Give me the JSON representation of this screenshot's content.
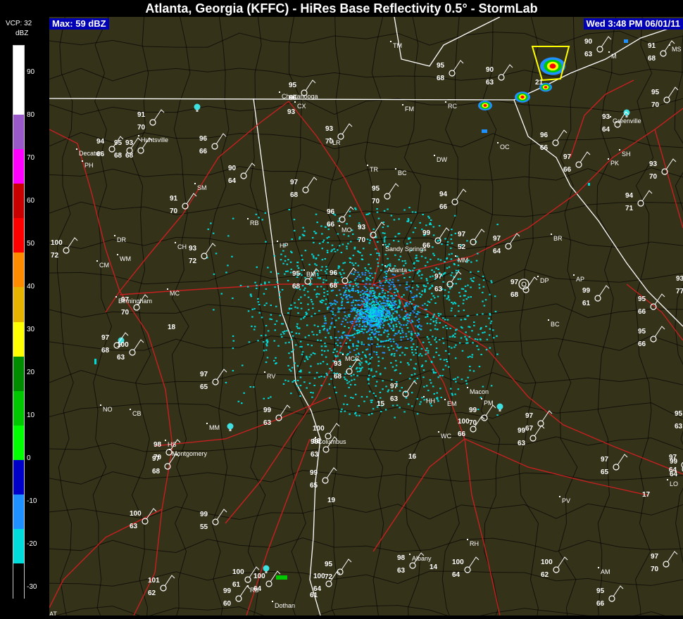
{
  "title": "Atlanta, Georgia (KFFC) - HiRes Base Reflectivity 0.5° - StormLab",
  "max_label": "Max: 59 dBZ",
  "time_label": "Wed 3:48 PM 06/01/11",
  "legend": {
    "vcp": "VCP: 32",
    "unit": "dBZ",
    "ticks": [
      "90",
      "80",
      "70",
      "60",
      "50",
      "40",
      "30",
      "20",
      "10",
      "0",
      "-10",
      "-20",
      "-30"
    ],
    "colors": [
      "#ffffff",
      "#ffffff",
      "#9a59c8",
      "#ff00ff",
      "#c80000",
      "#ff0000",
      "#ff8c00",
      "#e6b400",
      "#ffff00",
      "#008c00",
      "#00c800",
      "#00ff00",
      "#0000c8",
      "#1e90ff",
      "#00dcdc",
      "#000000"
    ]
  },
  "cities": [
    {
      "name": "TM"
    },
    {
      "name": "FM"
    },
    {
      "name": "RC"
    },
    {
      "name": "Chattanooga"
    },
    {
      "name": "CX"
    },
    {
      "name": "LR"
    },
    {
      "name": "Huntsville"
    },
    {
      "name": "Decatur"
    },
    {
      "name": "PH"
    },
    {
      "name": "SM"
    },
    {
      "name": "TR"
    },
    {
      "name": "BC"
    },
    {
      "name": "DW"
    },
    {
      "name": "OC"
    },
    {
      "name": "Greenville"
    },
    {
      "name": "SH"
    },
    {
      "name": "PK"
    },
    {
      "name": "RB"
    },
    {
      "name": "MO"
    },
    {
      "name": "HP"
    },
    {
      "name": "DR"
    },
    {
      "name": "WM"
    },
    {
      "name": "CM"
    },
    {
      "name": "CH"
    },
    {
      "name": "Sandy Springs"
    },
    {
      "name": "MM"
    },
    {
      "name": "BR"
    },
    {
      "name": "Atlanta"
    },
    {
      "name": "BM"
    },
    {
      "name": "Birmingham"
    },
    {
      "name": "MC"
    },
    {
      "name": "DP"
    },
    {
      "name": "AP"
    },
    {
      "name": "BC"
    },
    {
      "name": "MCC"
    },
    {
      "name": "RV"
    },
    {
      "name": "NO"
    },
    {
      "name": "CB"
    },
    {
      "name": "MM"
    },
    {
      "name": "HS"
    },
    {
      "name": "Montgomery"
    },
    {
      "name": "Columbus"
    },
    {
      "name": "HH"
    },
    {
      "name": "Macon"
    },
    {
      "name": "EM"
    },
    {
      "name": "PM"
    },
    {
      "name": "WC"
    },
    {
      "name": "PV"
    },
    {
      "name": "RH"
    },
    {
      "name": "Albany"
    },
    {
      "name": "RS"
    },
    {
      "name": "Dothan"
    },
    {
      "name": "AM"
    },
    {
      "name": "LO"
    },
    {
      "name": "M"
    },
    {
      "name": "MS"
    },
    {
      "name": "AT"
    }
  ],
  "stations": [
    {
      "t": "95",
      "d": "68"
    },
    {
      "t": "90",
      "d": "63"
    },
    {
      "t": "90",
      "d": "63"
    },
    {
      "t": "91",
      "d": "68"
    },
    {
      "t": "95",
      "d": "70"
    },
    {
      "t": "95",
      "d": "66"
    },
    {
      "t": "93",
      "d": "70"
    },
    {
      "t": "91",
      "d": "70"
    },
    {
      "t": "94",
      "d": "66"
    },
    {
      "t": "95",
      "d": "68"
    },
    {
      "t": "93",
      "d": "68"
    },
    {
      "t": "96",
      "d": "66"
    },
    {
      "t": "93",
      "d": "64"
    },
    {
      "t": "96",
      "d": "66"
    },
    {
      "t": "97",
      "d": "66"
    },
    {
      "t": "93",
      "d": "70"
    },
    {
      "t": "94",
      "d": "71"
    },
    {
      "t": "90",
      "d": "64"
    },
    {
      "t": "91",
      "d": "70"
    },
    {
      "t": "97",
      "d": "68"
    },
    {
      "t": "95",
      "d": "70"
    },
    {
      "t": "94",
      "d": "66"
    },
    {
      "t": "96",
      "d": "66"
    },
    {
      "t": "93",
      "d": "70"
    },
    {
      "t": "99",
      "d": "66"
    },
    {
      "t": "97",
      "d": "52"
    },
    {
      "t": "97",
      "d": "64"
    },
    {
      "t": "100",
      "d": "72"
    },
    {
      "t": "93",
      "d": "72"
    },
    {
      "t": "97",
      "d": "70"
    },
    {
      "t": "96",
      "d": "68"
    },
    {
      "t": "95",
      "d": "68"
    },
    {
      "t": "97",
      "d": "63"
    },
    {
      "t": "97",
      "d": "68"
    },
    {
      "t": "99",
      "d": "61"
    },
    {
      "t": "95",
      "d": "66"
    },
    {
      "t": "95",
      "d": "66"
    },
    {
      "t": "97",
      "d": "68"
    },
    {
      "t": "93",
      "d": "68"
    },
    {
      "t": "97",
      "d": "65"
    },
    {
      "t": "99",
      "d": "63"
    },
    {
      "t": "97",
      "d": "63"
    },
    {
      "t": "100",
      "d": "63"
    },
    {
      "t": "99",
      "d": "70"
    },
    {
      "t": "97",
      "d": "67"
    },
    {
      "t": "99",
      "d": "63"
    },
    {
      "t": "100",
      "d": "66"
    },
    {
      "t": "100",
      "d": "66"
    },
    {
      "t": "99",
      "d": "63"
    },
    {
      "t": "99",
      "d": "65"
    },
    {
      "t": "98",
      "d": "70"
    },
    {
      "t": "97",
      "d": "68"
    },
    {
      "t": "95",
      "d": "63"
    },
    {
      "t": "97",
      "d": "64"
    },
    {
      "t": "97",
      "d": "65"
    },
    {
      "t": "99",
      "d": "64"
    },
    {
      "t": "100",
      "d": "63"
    },
    {
      "t": "99",
      "d": "55"
    },
    {
      "t": "100",
      "d": "64"
    },
    {
      "t": "100",
      "d": "62"
    },
    {
      "t": "98",
      "d": "63"
    },
    {
      "t": "101",
      "d": "62"
    },
    {
      "t": "99",
      "d": "60"
    },
    {
      "t": "100",
      "d": "61"
    },
    {
      "t": "100",
      "d": "64"
    },
    {
      "t": "95",
      "d": "72"
    },
    {
      "t": "97",
      "d": "70"
    },
    {
      "t": "95",
      "d": "66"
    },
    {
      "t": "93",
      "d": "77"
    },
    {
      "t": "100",
      "d": "64"
    }
  ],
  "extra_labels": [
    "14",
    "15",
    "16",
    "17",
    "18",
    "19",
    "21",
    "93",
    "61"
  ]
}
